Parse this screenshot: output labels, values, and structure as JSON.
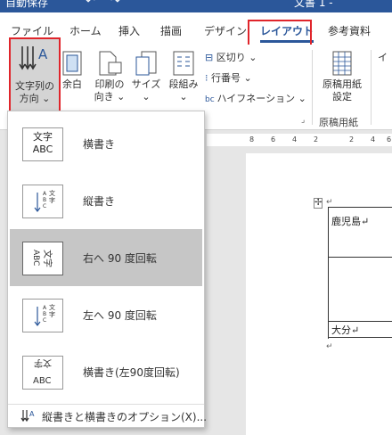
{
  "titlebar": {
    "autosave": "自動保存",
    "doc_title": "文書 1 -"
  },
  "tabs": [
    "ファイル",
    "ホーム",
    "挿入",
    "描画",
    "デザイン",
    "レイアウト",
    "参考資料"
  ],
  "ribbon": {
    "text_direction": [
      "文字列の",
      "方向 ⌄"
    ],
    "margins": "余白",
    "orientation": [
      "印刷の",
      "向き ⌄"
    ],
    "size": [
      "サイズ",
      "⌄"
    ],
    "columns": [
      "段組み",
      "⌄"
    ],
    "breaks": "区切り ⌄",
    "line_numbers": "行番号 ⌄",
    "hyphenation": "ハイフネーション ⌄",
    "manuscript": [
      "原稿用紙",
      "設定"
    ],
    "manuscript_group": "原稿用紙",
    "indent_partial": "イ"
  },
  "ruler": [
    "8",
    "6",
    "4",
    "2",
    "",
    "2",
    "4",
    "6"
  ],
  "dropdown": {
    "items": [
      {
        "label": "横書き",
        "icon": "horizontal-text-icon",
        "selected": false
      },
      {
        "label": "縦書き",
        "icon": "vertical-text-icon",
        "selected": false
      },
      {
        "label": "右へ 90 度回転",
        "icon": "rotate-right-90-icon",
        "selected": true
      },
      {
        "label": "左へ 90 度回転",
        "icon": "rotate-left-90-icon",
        "selected": false
      },
      {
        "label": "横書き(左90度回転)",
        "icon": "horizontal-rotate-left-icon",
        "selected": false
      }
    ],
    "footer": "縦書きと横書きのオプション(X)..."
  },
  "document": {
    "cell1": "鹿児島↵",
    "cell2": "大分↵",
    "para_mark": "↵"
  },
  "icon_sample": {
    "ja": "文字",
    "en": "ABC"
  },
  "colors": {
    "accent": "#2b579a",
    "highlight": "#e0252b",
    "selected_bg": "#c6c6c6"
  }
}
